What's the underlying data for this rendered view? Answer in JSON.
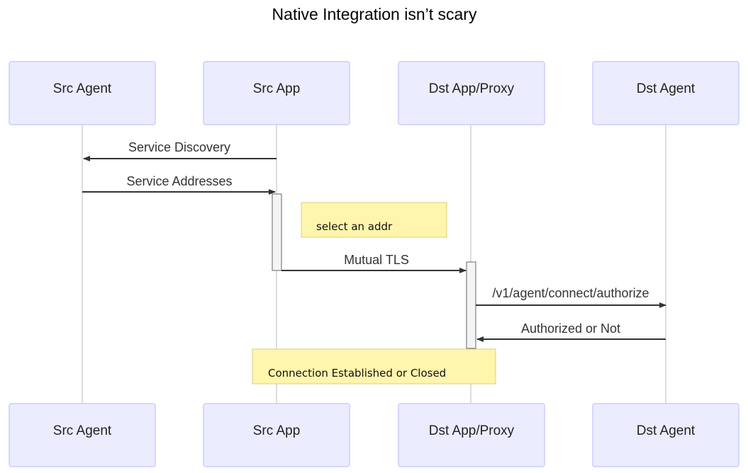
{
  "title": "Native Integration isn’t scary",
  "participants": [
    {
      "id": "src_agent",
      "label": "Src Agent"
    },
    {
      "id": "src_app",
      "label": "Src App"
    },
    {
      "id": "dst_app",
      "label": "Dst App/Proxy"
    },
    {
      "id": "dst_agent",
      "label": "Dst Agent"
    }
  ],
  "messages": [
    {
      "from": "src_app",
      "to": "src_agent",
      "label": "Service Discovery"
    },
    {
      "from": "src_agent",
      "to": "src_app",
      "label": "Service Addresses"
    },
    {
      "from": "src_app",
      "to": "dst_app",
      "label": "Mutual TLS"
    },
    {
      "from": "dst_app",
      "to": "dst_agent",
      "label": "/v1/agent/connect/authorize"
    },
    {
      "from": "dst_agent",
      "to": "dst_app",
      "label": "Authorized or Not"
    }
  ],
  "notes": [
    {
      "label": "select an addr"
    },
    {
      "label": "Connection Established or Closed"
    }
  ],
  "colors": {
    "actor_fill": "#ececff",
    "actor_border": "#ccccff",
    "note_fill": "#fff5ad",
    "note_border": "#d8d27a",
    "line": "#333333"
  }
}
